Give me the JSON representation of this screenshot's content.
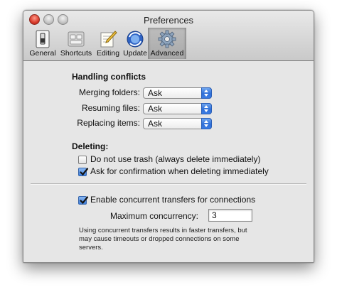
{
  "window": {
    "title": "Preferences"
  },
  "toolbar": {
    "items": [
      {
        "label": "General",
        "icon": "switch-icon"
      },
      {
        "label": "Shortcuts",
        "icon": "keyboard-icon"
      },
      {
        "label": "Editing",
        "icon": "pencil-paper-icon"
      },
      {
        "label": "Update",
        "icon": "refresh-globe-icon"
      },
      {
        "label": "Advanced",
        "icon": "gear-icon",
        "selected": true
      }
    ]
  },
  "conflicts": {
    "heading": "Handling conflicts",
    "rows": [
      {
        "label": "Merging folders:",
        "value": "Ask"
      },
      {
        "label": "Resuming files:",
        "value": "Ask"
      },
      {
        "label": "Replacing items:",
        "value": "Ask"
      }
    ]
  },
  "deleting": {
    "heading": "Deleting:",
    "options": [
      {
        "label": "Do not use trash (always delete immediately)",
        "checked": false
      },
      {
        "label": "Ask for confirmation when deleting immediately",
        "checked": true
      }
    ]
  },
  "concurrency": {
    "enable_label": "Enable concurrent transfers for connections",
    "enable_checked": true,
    "max_label": "Maximum concurrency:",
    "max_value": "3",
    "note_lines": [
      "Using concurrent transfers results in faster transfers, but",
      "may cause timeouts or dropped connections on some",
      "servers."
    ]
  },
  "colors": {
    "accent": "#3e7fdc",
    "window_bg": "#e6e6e6"
  }
}
